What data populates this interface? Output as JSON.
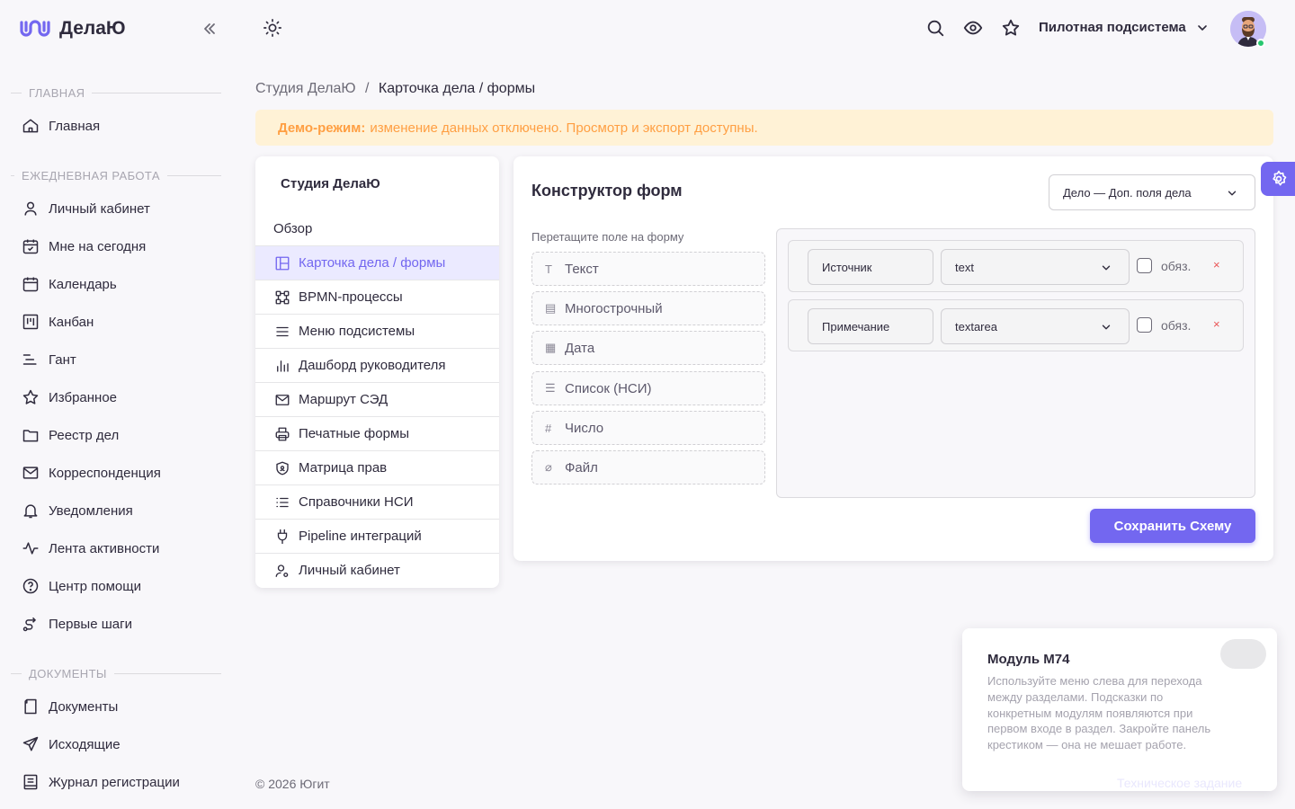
{
  "app": {
    "name": "ДелаЮ"
  },
  "header": {
    "subsystem": "Пилотная подсистема"
  },
  "sidebar": {
    "sections": [
      {
        "title": "ГЛАВНАЯ"
      },
      {
        "title": "ЕЖЕДНЕВНАЯ РАБОТА"
      },
      {
        "title": "ДОКУМЕНТЫ"
      }
    ],
    "items": [
      {
        "label": "Главная",
        "icon": "home-icon"
      },
      {
        "label": "Личный кабинет",
        "icon": "user-icon"
      },
      {
        "label": "Мне на сегодня",
        "icon": "calendar-check-icon"
      },
      {
        "label": "Календарь",
        "icon": "calendar-icon"
      },
      {
        "label": "Канбан",
        "icon": "kanban-icon"
      },
      {
        "label": "Гант",
        "icon": "gantt-icon"
      },
      {
        "label": "Избранное",
        "icon": "star-icon"
      },
      {
        "label": "Реестр дел",
        "icon": "folder-icon"
      },
      {
        "label": "Корреспонденция",
        "icon": "mail-icon"
      },
      {
        "label": "Уведомления",
        "icon": "bell-icon"
      },
      {
        "label": "Лента активности",
        "icon": "activity-icon"
      },
      {
        "label": "Центр помощи",
        "icon": "help-icon"
      },
      {
        "label": "Первые шаги",
        "icon": "route-icon"
      },
      {
        "label": "Документы",
        "icon": "document-icon"
      },
      {
        "label": "Исходящие",
        "icon": "send-icon"
      },
      {
        "label": "Журнал регистрации",
        "icon": "journal-icon"
      }
    ]
  },
  "breadcrumb": {
    "root": "Студия ДелаЮ",
    "separator": "/",
    "current": "Карточка дела / формы"
  },
  "demo_banner": {
    "label": "Демо-режим:",
    "text": "изменение данных отключено. Просмотр и экспорт доступны."
  },
  "studio": {
    "title": "Студия ДелаЮ",
    "overview": "Обзор",
    "items": [
      {
        "label": "Карточка дела / формы",
        "icon": "layout-icon",
        "active": true
      },
      {
        "label": "BPMN-процессы",
        "icon": "bpmn-icon"
      },
      {
        "label": "Меню подсистемы",
        "icon": "menu-icon"
      },
      {
        "label": "Дашборд руководителя",
        "icon": "bar-chart-icon"
      },
      {
        "label": "Маршрут СЭД",
        "icon": "mail-route-icon"
      },
      {
        "label": "Печатные формы",
        "icon": "printer-icon"
      },
      {
        "label": "Матрица прав",
        "icon": "shield-icon"
      },
      {
        "label": "Справочники НСИ",
        "icon": "list-icon"
      },
      {
        "label": "Pipeline интеграций",
        "icon": "plug-icon"
      },
      {
        "label": "Личный кабинет",
        "icon": "user-settings-icon"
      }
    ]
  },
  "constructor": {
    "title": "Конструктор форм",
    "entity": "Дело — Доп. поля дела",
    "palette_label": "Перетащите поле на форму",
    "palette": [
      {
        "label": "Текст",
        "glyph": "T"
      },
      {
        "label": "Многострочный",
        "glyph": "▤"
      },
      {
        "label": "Дата",
        "glyph": "▦"
      },
      {
        "label": "Список (НСИ)",
        "glyph": "☰"
      },
      {
        "label": "Число",
        "glyph": "#"
      },
      {
        "label": "Файл",
        "glyph": "⌀"
      }
    ],
    "fields": [
      {
        "name": "Источник",
        "type": "text",
        "required_label": "обяз.",
        "required": false,
        "delete": "×"
      },
      {
        "name": "Примечание",
        "type": "textarea",
        "required_label": "обяз.",
        "required": false,
        "delete": "×"
      }
    ],
    "save_label": "Сохранить Схему"
  },
  "footer": {
    "text": "© 2026 Югит"
  },
  "tip": {
    "title": "Модуль M74",
    "text": "Используйте меню слева для перехода между разделами. Подсказки по конкретным модулям появляются при первом входе в раздел. Закройте панель крестиком — она не мешает работе.",
    "link": "Техническое задание"
  },
  "colors": {
    "accent": "#7367f0",
    "warning_bg": "#fff2d6",
    "warning_text": "#ff9f43",
    "danger": "#ea5455",
    "online": "#28c76f"
  }
}
